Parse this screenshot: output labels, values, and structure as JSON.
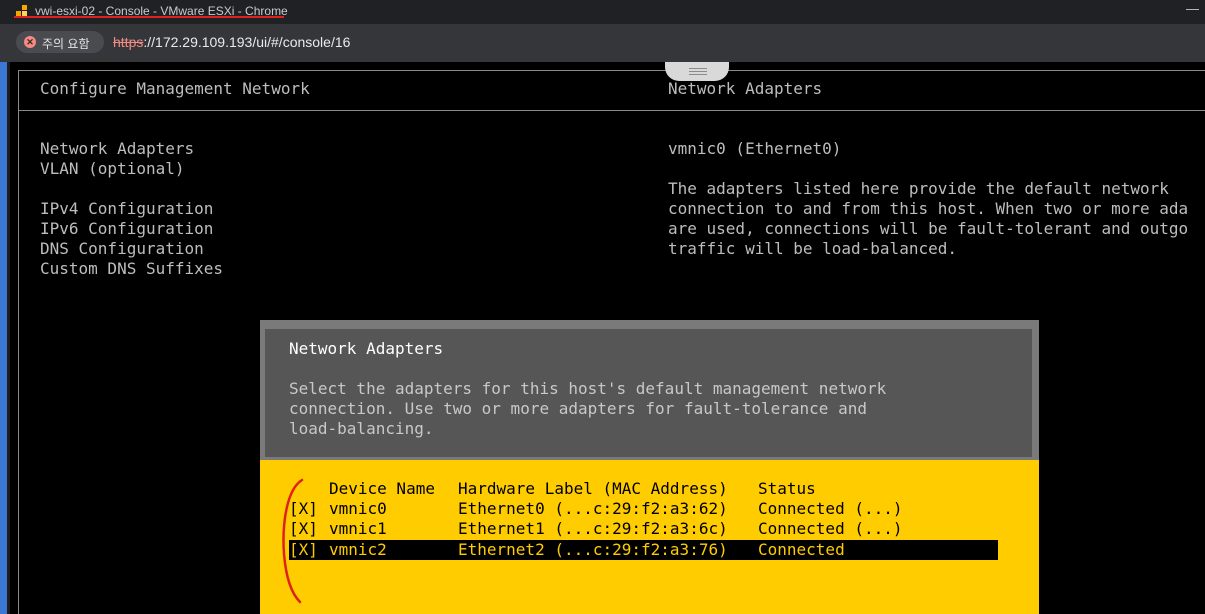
{
  "browser": {
    "window_title": "vwi-esxi-02 - Console - VMware ESXi - Chrome",
    "minimize_glyph": "—",
    "security_chip": "주의 요함",
    "url_scheme": "https",
    "url_rest": "://172.29.109.193/ui/#/console/16"
  },
  "console": {
    "left_title": "Configure Management Network",
    "right_title": "Network Adapters",
    "menu_items": [
      "Network Adapters",
      "VLAN (optional)",
      "IPv4 Configuration",
      "IPv6 Configuration",
      "DNS Configuration",
      "Custom DNS Suffixes"
    ],
    "selected_adapter_summary": "vmnic0 (Ethernet0)",
    "description_lines": [
      "The adapters listed here provide the default network",
      "connection to and from this host. When two or more ada",
      "are used, connections will be fault-tolerant and outgo",
      "traffic will be load-balanced."
    ]
  },
  "dialog": {
    "title": "Network Adapters",
    "instructions_lines": [
      "Select the adapters for this host's default management network",
      "connection. Use two or more adapters for fault-tolerance and",
      "load-balancing."
    ],
    "columns": {
      "device": "Device Name",
      "hardware": "Hardware Label (MAC Address)",
      "status": "Status"
    },
    "rows": [
      {
        "check": "[X]",
        "device": "vmnic0",
        "hardware": "Ethernet0 (...c:29:f2:a3:62)",
        "status": "Connected (...)"
      },
      {
        "check": "[X]",
        "device": "vmnic1",
        "hardware": "Ethernet1 (...c:29:f2:a3:6c)",
        "status": "Connected (...)"
      },
      {
        "check": "[X]",
        "device": "vmnic2",
        "hardware": "Ethernet2 (...c:29:f2:a3:76)",
        "status": "Connected"
      }
    ]
  },
  "colors": {
    "dialog_body": "#ffcc00",
    "dialog_head": "#565656",
    "annotation_red": "#e0201b",
    "left_edge_blue": "#3b78d6"
  }
}
